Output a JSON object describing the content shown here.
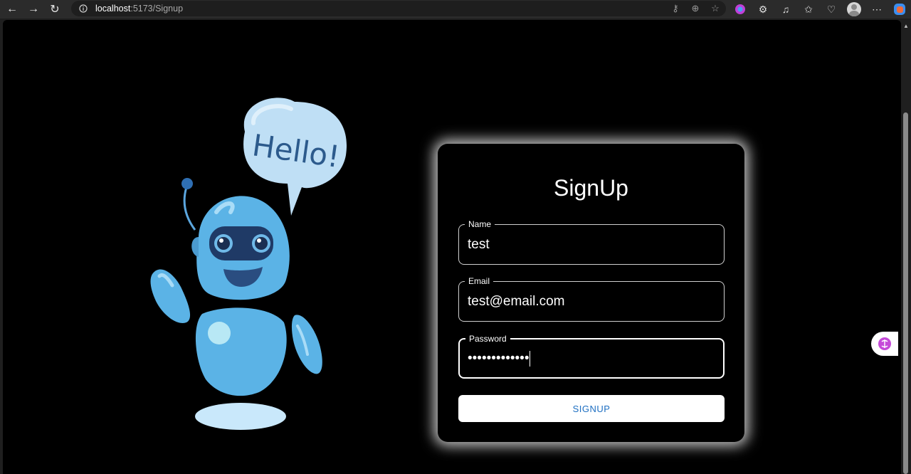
{
  "browser": {
    "url_host": "localhost",
    "url_path": ":5173/Signup"
  },
  "form": {
    "title": "SignUp",
    "fields": [
      {
        "label": "Name",
        "value": "test"
      },
      {
        "label": "Email",
        "value": "test@email.com"
      },
      {
        "label": "Password",
        "value": "•••••••••••••"
      }
    ],
    "submit_label": "SIGNUP"
  },
  "illustration": {
    "speech_text": "Hello!"
  },
  "colors": {
    "page_bg": "#000000",
    "button_text": "#1e6fc2",
    "robot_body": "#5bb3e6"
  }
}
